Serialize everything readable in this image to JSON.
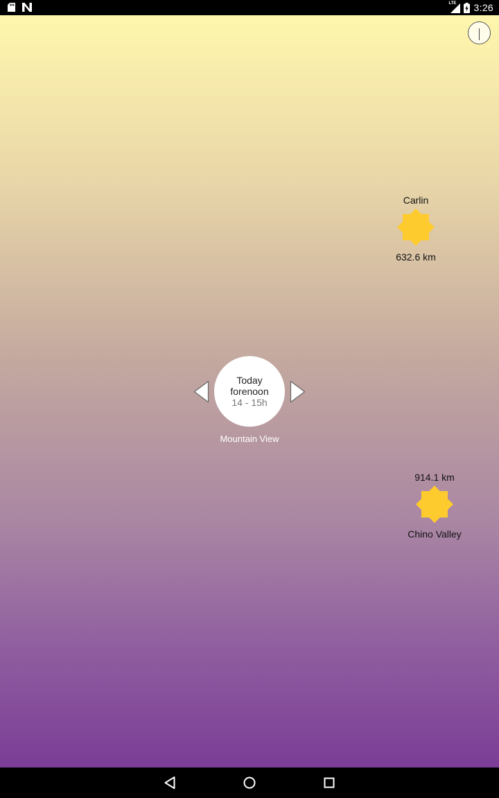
{
  "status_bar": {
    "time": "3:26",
    "network": "LTE",
    "icons": [
      "sd-card-icon",
      "n-notification-icon",
      "lte-signal-icon",
      "battery-charging-icon"
    ]
  },
  "main": {
    "info_icon": "info-icon",
    "center": {
      "day": "Today",
      "period": "forenoon",
      "hours": "14 - 15h",
      "location": "Mountain View"
    },
    "places": [
      {
        "name": "Carlin",
        "distance": "632.6 km",
        "icon": "sun-icon"
      },
      {
        "name": "Chino Valley",
        "distance": "914.1 km",
        "icon": "sun-icon"
      }
    ]
  },
  "colors": {
    "gradient_top": "#fff7ad",
    "gradient_bottom": "#7b3d96",
    "sun": "#fecb2f"
  },
  "nav_bar": {
    "icons": [
      "back-icon",
      "home-icon",
      "recents-icon"
    ]
  }
}
